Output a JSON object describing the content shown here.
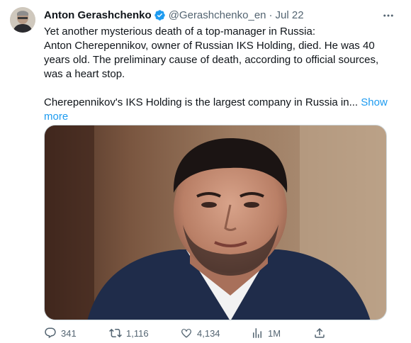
{
  "author": {
    "name": "Anton Gerashchenko",
    "handle": "@Gerashchenko_en",
    "separator": "·",
    "date": "Jul 22"
  },
  "tweet": {
    "lines": [
      "Yet another mysterious death of a top-manager in Russia:",
      "Anton Cherepennikov, owner of Russian IKS Holding, died. He was 40 years old. The preliminary cause of death, according to official sources, was a heart stop."
    ],
    "truncated_text": "Cherepennikov's IKS Holding is the largest company in Russia in...",
    "show_more": "Show more"
  },
  "actions": {
    "replies": "341",
    "retweets": "1,116",
    "likes": "4,134",
    "views": "1M"
  },
  "colors": {
    "accent": "#1d9bf0",
    "muted": "#536471",
    "text": "#0f1419"
  }
}
